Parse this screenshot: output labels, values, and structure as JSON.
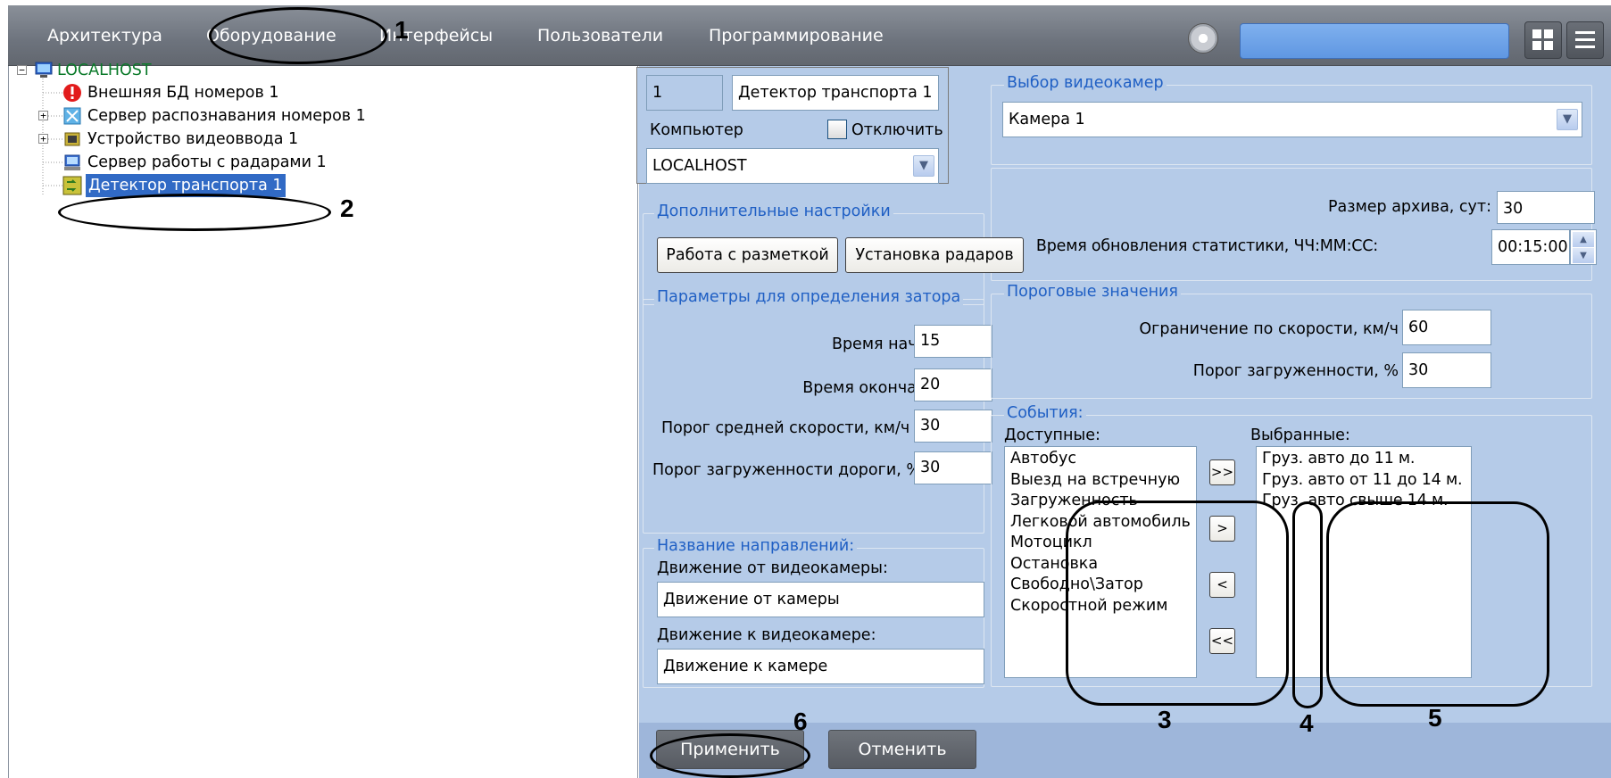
{
  "menu": {
    "tabs": [
      "Архитектура",
      "Оборудование",
      "Интерфейсы",
      "Пользователи",
      "Программирование"
    ],
    "active_tab": "Оборудование",
    "search_value": ""
  },
  "tree": {
    "root": "LOCALHOST",
    "items": [
      "Внешняя БД номеров 1",
      "Сервер распознавания номеров 1",
      "Устройство видеоввода 1",
      "Сервер работы с радарами 1",
      "Детектор транспорта 1"
    ]
  },
  "header": {
    "id": "1",
    "name": "Детектор транспорта 1",
    "computer_label": "Компьютер",
    "disable_label": "Отключить",
    "computer_value": "LOCALHOST"
  },
  "camera": {
    "title": "Выбор видеокамер",
    "value": "Камера 1"
  },
  "archive": {
    "size_label": "Размер архива, сут:",
    "size_value": "30",
    "update_label": "Время обновления статистики, ЧЧ:ММ:СС:",
    "update_value": "00:15:00"
  },
  "extra": {
    "title": "Дополнительные настройки",
    "markup_button": "Работа с разметкой",
    "radar_button": "Установка радаров"
  },
  "jam": {
    "title": "Параметры для определения затора",
    "start_label": "Время начала, с",
    "start_value": "15",
    "end_label": "Время окончания, с",
    "end_value": "20",
    "speed_label": "Порог средней скорости, км/ч",
    "speed_value": "30",
    "load_label": "Порог загруженности дороги, %",
    "load_value": "30"
  },
  "thresholds": {
    "title": "Пороговые значения",
    "speed_label": "Ограничение по скорости, км/ч",
    "speed_value": "60",
    "load_label": "Порог загруженности, %",
    "load_value": "30"
  },
  "directions": {
    "title": "Название направлений:",
    "from_label": "Движение от видеокамеры:",
    "from_value": "Движение от камеры",
    "to_label": "Движение к видеокамере:",
    "to_value": "Движение к камере"
  },
  "events": {
    "title": "События:",
    "available_label": "Доступные:",
    "selected_label": "Выбранные:",
    "available": [
      "Автобус",
      "Выезд на встречную",
      "Загруженность",
      "Легковой автомобиль",
      "Мотоцикл",
      "Остановка",
      "Свободно\\Затор",
      "Скоростной режим"
    ],
    "selected": [
      "Груз. авто до 11 м.",
      "Груз. авто от 11 до 14 м.",
      "Груз. авто свыше 14 м."
    ],
    "move_all_right": ">>",
    "move_right": ">",
    "move_left": "<",
    "move_all_left": "<<"
  },
  "footer": {
    "apply": "Применить",
    "cancel": "Отменить"
  },
  "annotations": [
    "1",
    "2",
    "3",
    "4",
    "5",
    "6"
  ]
}
